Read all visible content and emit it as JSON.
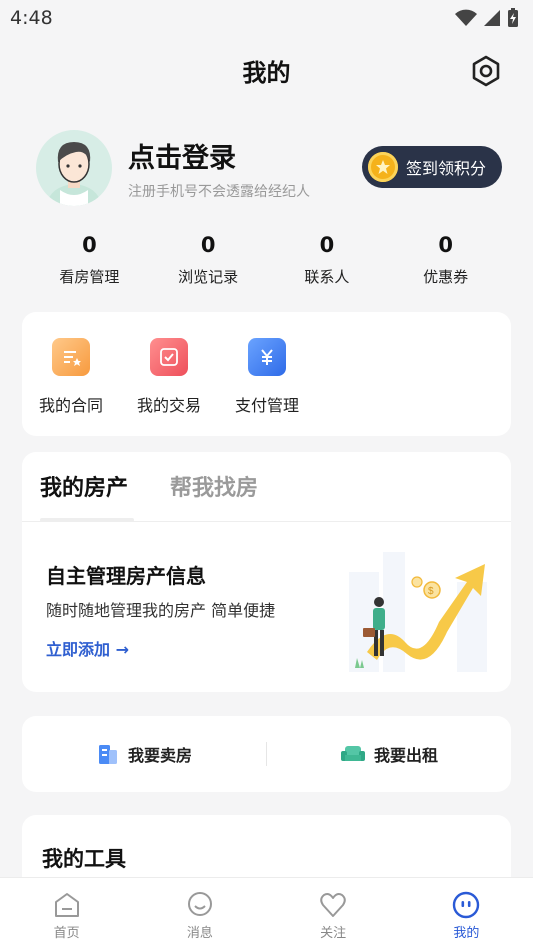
{
  "status_bar": {
    "time": "4:48"
  },
  "header": {
    "title": "我的"
  },
  "profile": {
    "login_title": "点击登录",
    "login_subtitle": "注册手机号不会透露给经纪人",
    "checkin_label": "签到领积分"
  },
  "stats": [
    {
      "value": "0",
      "label": "看房管理"
    },
    {
      "value": "0",
      "label": "浏览记录"
    },
    {
      "value": "0",
      "label": "联系人"
    },
    {
      "value": "0",
      "label": "优惠券"
    }
  ],
  "services": [
    {
      "label": "我的合同",
      "icon": "contract-icon"
    },
    {
      "label": "我的交易",
      "icon": "transaction-icon"
    },
    {
      "label": "支付管理",
      "icon": "payment-icon"
    }
  ],
  "property": {
    "tabs": [
      "我的房产",
      "帮我找房"
    ],
    "title": "自主管理房产信息",
    "subtitle": "随时随地管理我的房产 简单便捷",
    "link": "立即添加 →",
    "illustration_coin_symbol": "$"
  },
  "actions": {
    "sell": "我要卖房",
    "rent": "我要出租"
  },
  "tools": {
    "title": "我的工具"
  },
  "tabbar": [
    {
      "label": "首页",
      "icon": "home-icon"
    },
    {
      "label": "消息",
      "icon": "message-icon"
    },
    {
      "label": "关注",
      "icon": "heart-icon"
    },
    {
      "label": "我的",
      "icon": "profile-icon",
      "active": true
    }
  ],
  "colors": {
    "accent": "#2a5ad6",
    "checkin_bg": "#2a3348",
    "link": "#2f5fd0",
    "background": "#f5f5f6"
  }
}
